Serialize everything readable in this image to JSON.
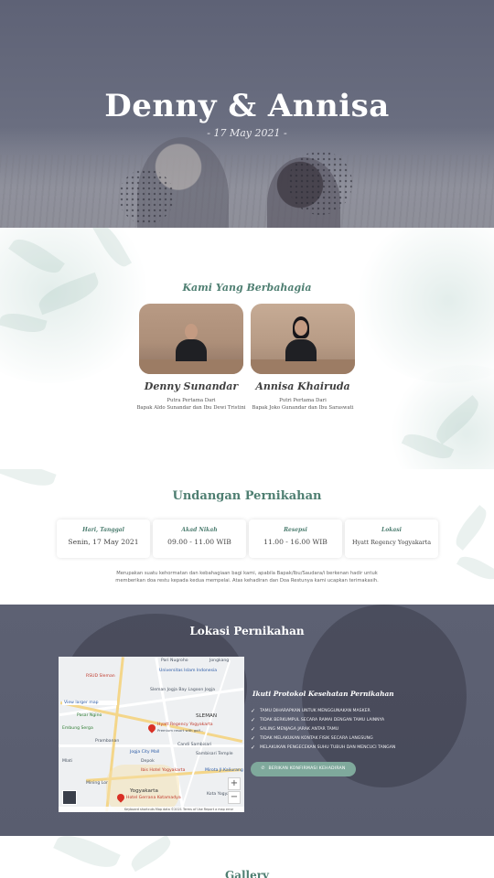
{
  "hero": {
    "couple_title": "Denny & Annisa",
    "date_line": "- 17 May 2021 -"
  },
  "couple": {
    "heading": "Kami Yang Berbahagia",
    "groom": {
      "name": "Denny Sunandar",
      "relation": "Putra Pertama Dari",
      "parents": "Bapak Aldo Sunandar dan Ibu Dewi Tristini"
    },
    "bride": {
      "name": "Annisa Khairuda",
      "relation": "Putri Pertama Dari",
      "parents": "Bapak Joko Gunandar dan Ibu Saraswati"
    }
  },
  "invitation": {
    "title": "Undangan Pernikahan",
    "cards": [
      {
        "label": "Hari, Tanggal",
        "value": "Senin, 17 May 2021"
      },
      {
        "label": "Akad Nikah",
        "value": "09.00 - 11.00 WIB"
      },
      {
        "label": "Resepsi",
        "value": "11.00 - 16.00 WIB"
      },
      {
        "label": "Lokasi",
        "value": "Hyatt Regency Yogyakarta"
      }
    ],
    "text_line1": "Merupakan suatu kehormatan dan kebahagiaan bagi kami, apabila Bapak/Ibu/Saudara/i berkenan hadir untuk",
    "text_line2": "memberikan doa restu kepada kedua mempelai. Atas kehadiran dan Doa Restunya kami ucapkan terimakasih."
  },
  "location": {
    "title": "Lokasi Pernikahan",
    "map": {
      "labels": {
        "top1": "Pari Nugroho",
        "top2": "Jongkang",
        "univ": "Universitas Islam Indonesia",
        "rsud": "RSUD Sleman",
        "lagoon": "Sleman Jogja Bay Lagoon Jogja",
        "view": "View larger map",
        "pasar": "Pasar Ngino",
        "sleman": "SLEMAN",
        "embung": "Embung Serga",
        "hyatt": "Hyatt Regency Yogyakarta",
        "hyatt_sub": "Premium resort with golf...",
        "prambanan": "Prambanan",
        "candi": "Candi Sambisari",
        "jogja": "Jogja City Mall",
        "depok": "Depok",
        "sambisari": "Sambisari Temple",
        "mlati": "Mlati",
        "ibis": "Ibis Hotel Yogyakarta",
        "hyatt2": "Hyatt Regency Yogyakarta",
        "mirota": "Mirota Jl.Kaliurang",
        "mining": "Mining Lor",
        "yogyakarta": "Yogyakarta",
        "kota": "Kota Yogyakarta",
        "hotel": "Hotel Gerrana Kotamadya",
        "footer": "Keyboard shortcuts  Map data ©2021  Terms of Use  Report a map error"
      },
      "zoom_in": "+",
      "zoom_out": "−"
    },
    "protocol_title": "Ikuti Protokol Kesehatan Pernikahan",
    "protocols": [
      "TAMU DIHARAPKAN UNTUK MENGGUNAKAN MASKER",
      "TIDAK BERKUMPUL SECARA RAMAI DENGAN TAMU LAINNYA",
      "SALING MENJAGA JARAK ANTAR TAMU",
      "TIDAK MELAKUKAN KONTAK FISIK SECARA LANGSUNG",
      "MELAKUKAN PENGECEKAN SUHU TUBUH DAN MENCUCI TANGAN"
    ],
    "rsvp_label": "BERIKAN KONFIRMASI KEHADIRAN",
    "check_glyph": "✓",
    "whatsapp_glyph": "✆"
  },
  "gallery": {
    "title": "Gallery"
  },
  "colors": {
    "accent": "#4f7f72",
    "button": "#7fa99c",
    "hero_overlay": "#5e6276"
  }
}
